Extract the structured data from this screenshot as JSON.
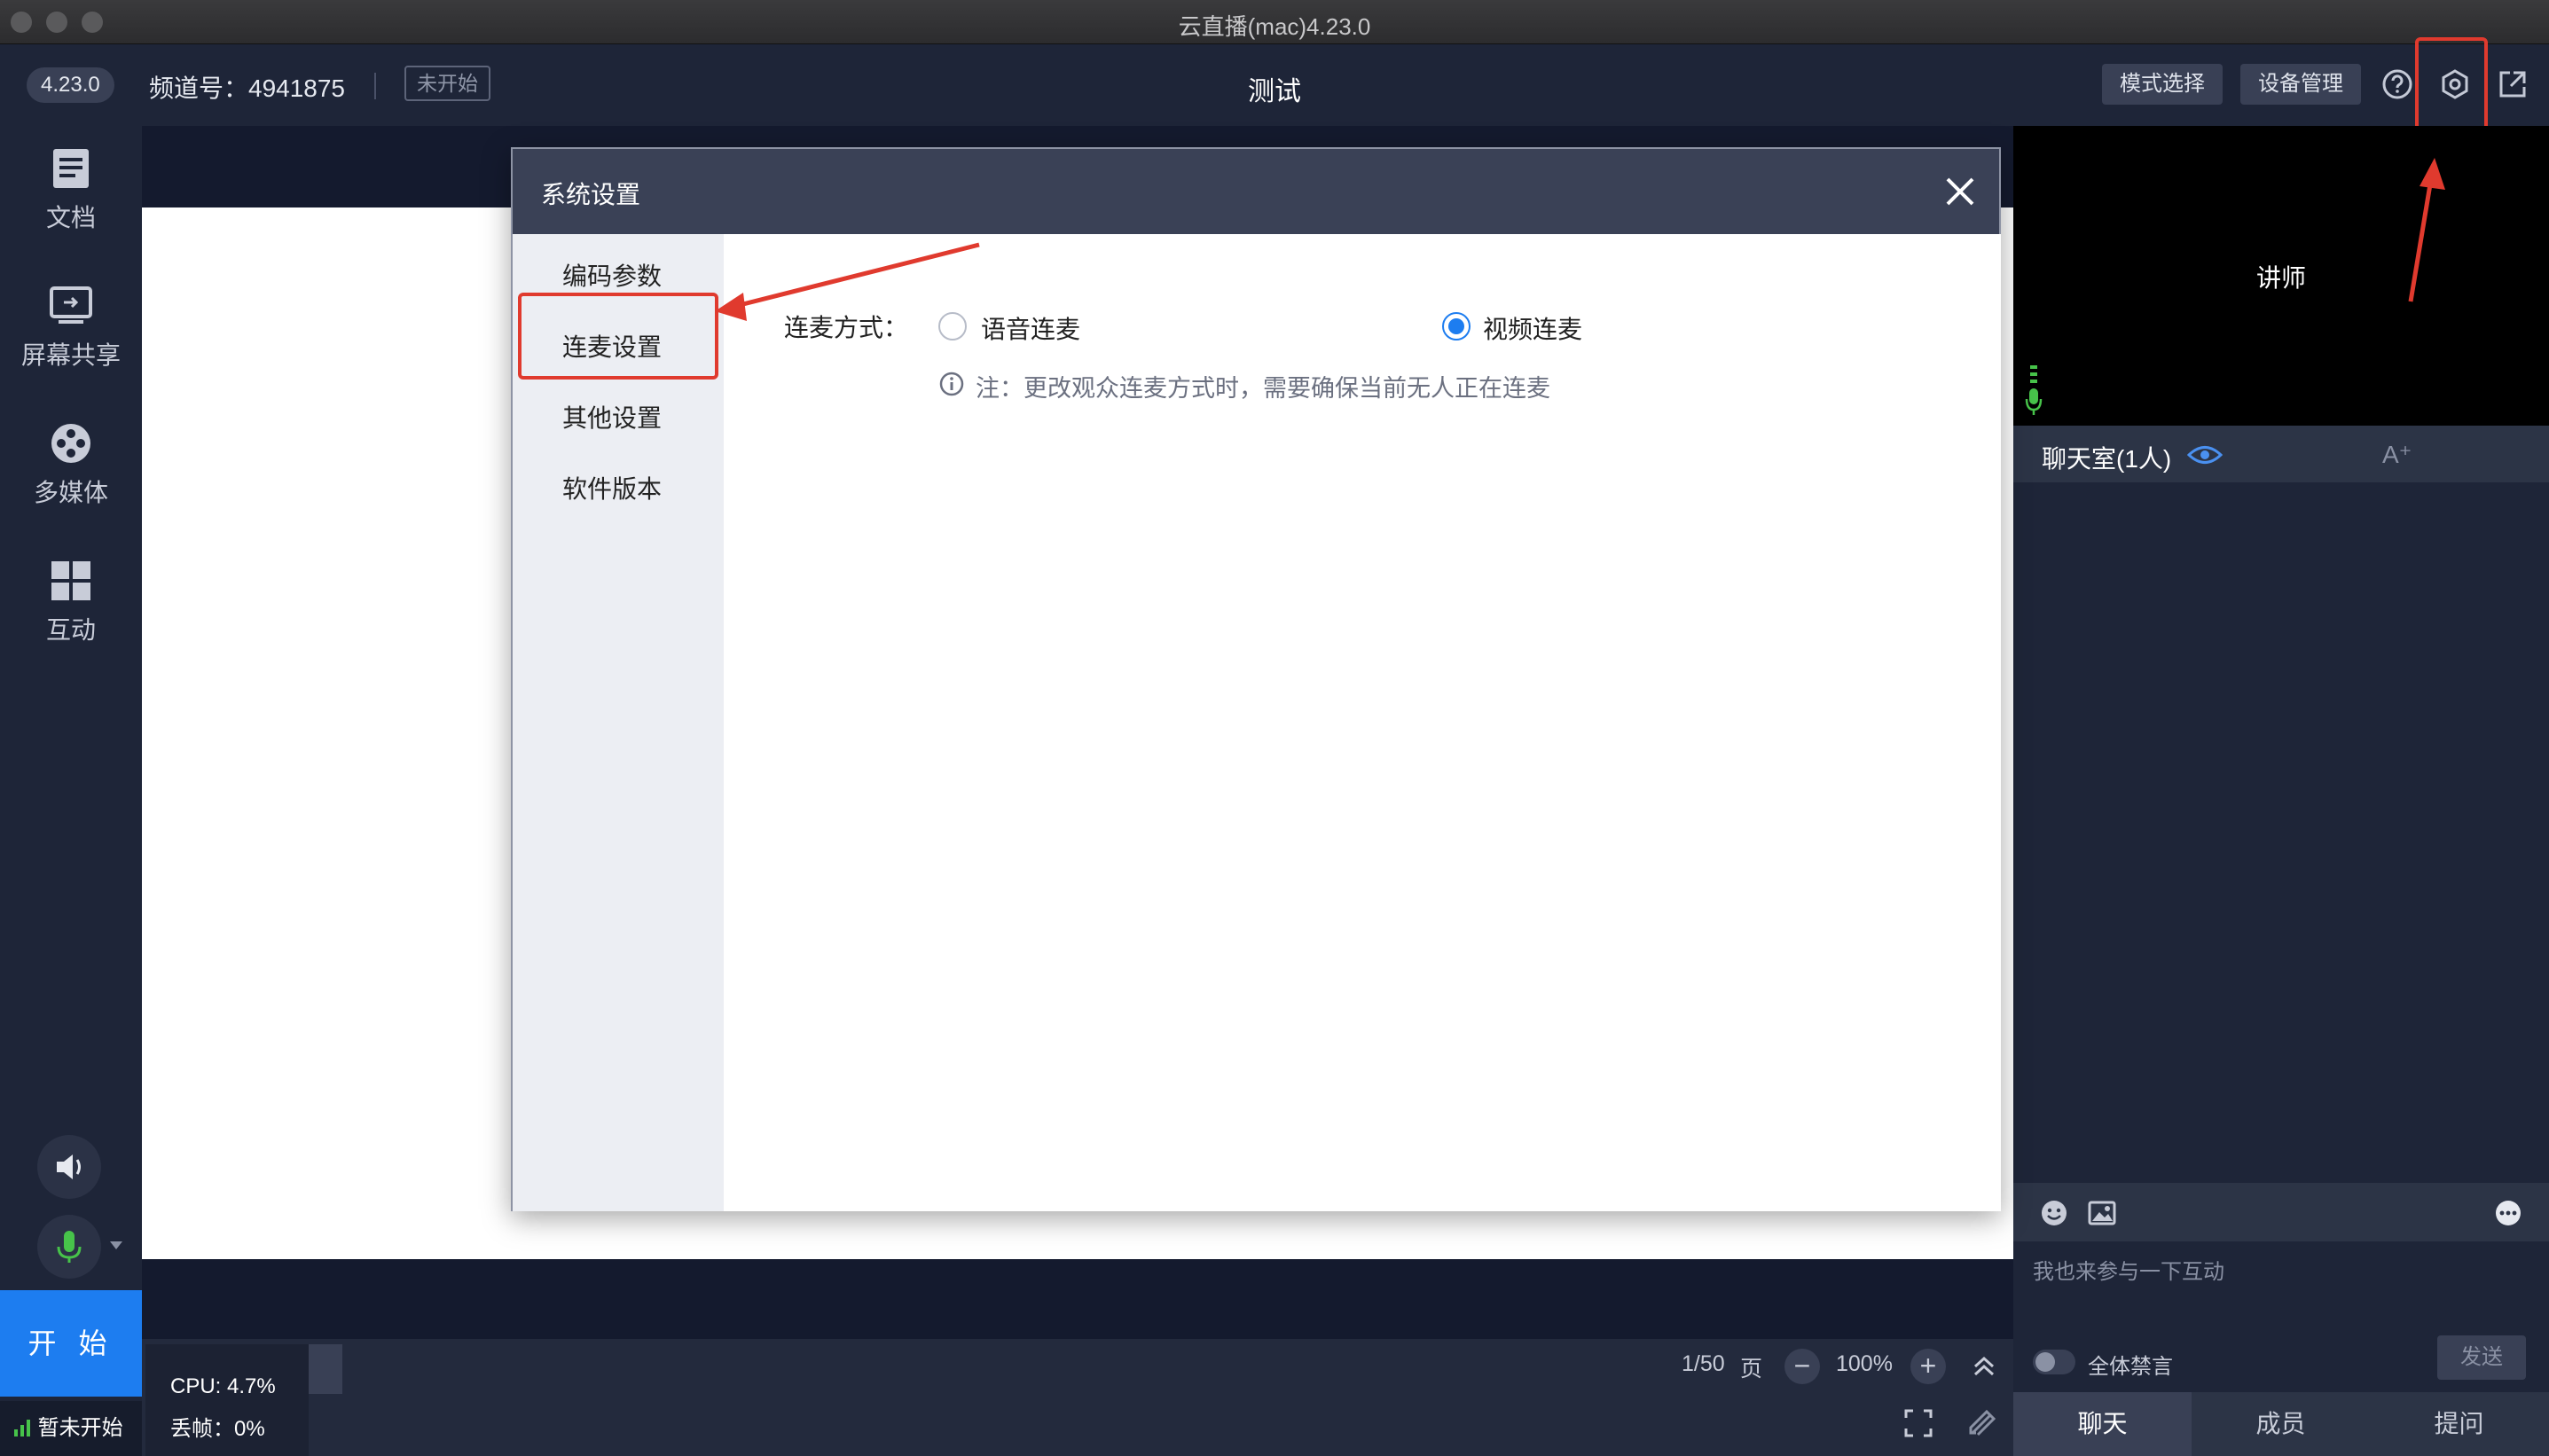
{
  "window": {
    "title": "云直播(mac)4.23.0"
  },
  "header": {
    "version_badge": "4.23.0",
    "channel_label": "频道号：4941875",
    "status_tag": "未开始",
    "room_title": "测试",
    "mode_button": "模式选择",
    "device_button": "设备管理"
  },
  "sidebar": {
    "items": [
      {
        "label": "文档",
        "icon": "document-icon"
      },
      {
        "label": "屏幕共享",
        "icon": "screen-share-icon"
      },
      {
        "label": "多媒体",
        "icon": "multimedia-icon"
      },
      {
        "label": "互动",
        "icon": "grid-icon"
      }
    ],
    "start_button": "开 始",
    "status_text": "暂未开始"
  },
  "stats": {
    "cpu": "CPU: 4.7%",
    "dropped": "丢帧：0%"
  },
  "pager": {
    "page": "1/50",
    "page_unit": "页",
    "zoom": "100%"
  },
  "video": {
    "speaker_label": "讲师"
  },
  "chat": {
    "title": "聊天室(1人)",
    "font_size_icon": "A⁺",
    "input_placeholder": "我也来参与一下互动",
    "mute_all_label": "全体禁言",
    "send_button": "发送",
    "tabs": [
      "聊天",
      "成员",
      "提问"
    ]
  },
  "dialog": {
    "title": "系统设置",
    "nav": [
      "编码参数",
      "连麦设置",
      "其他设置",
      "软件版本"
    ],
    "selected_nav": "连麦设置",
    "field_label": "连麦方式：",
    "options": [
      {
        "label": "语音连麦",
        "selected": false
      },
      {
        "label": "视频连麦",
        "selected": true
      }
    ],
    "note": "注：更改观众连麦方式时，需要确保当前无人正在连麦"
  },
  "colors": {
    "accent": "#1d7df0",
    "annotation": "#e03a2e",
    "background": "#1e2538"
  }
}
